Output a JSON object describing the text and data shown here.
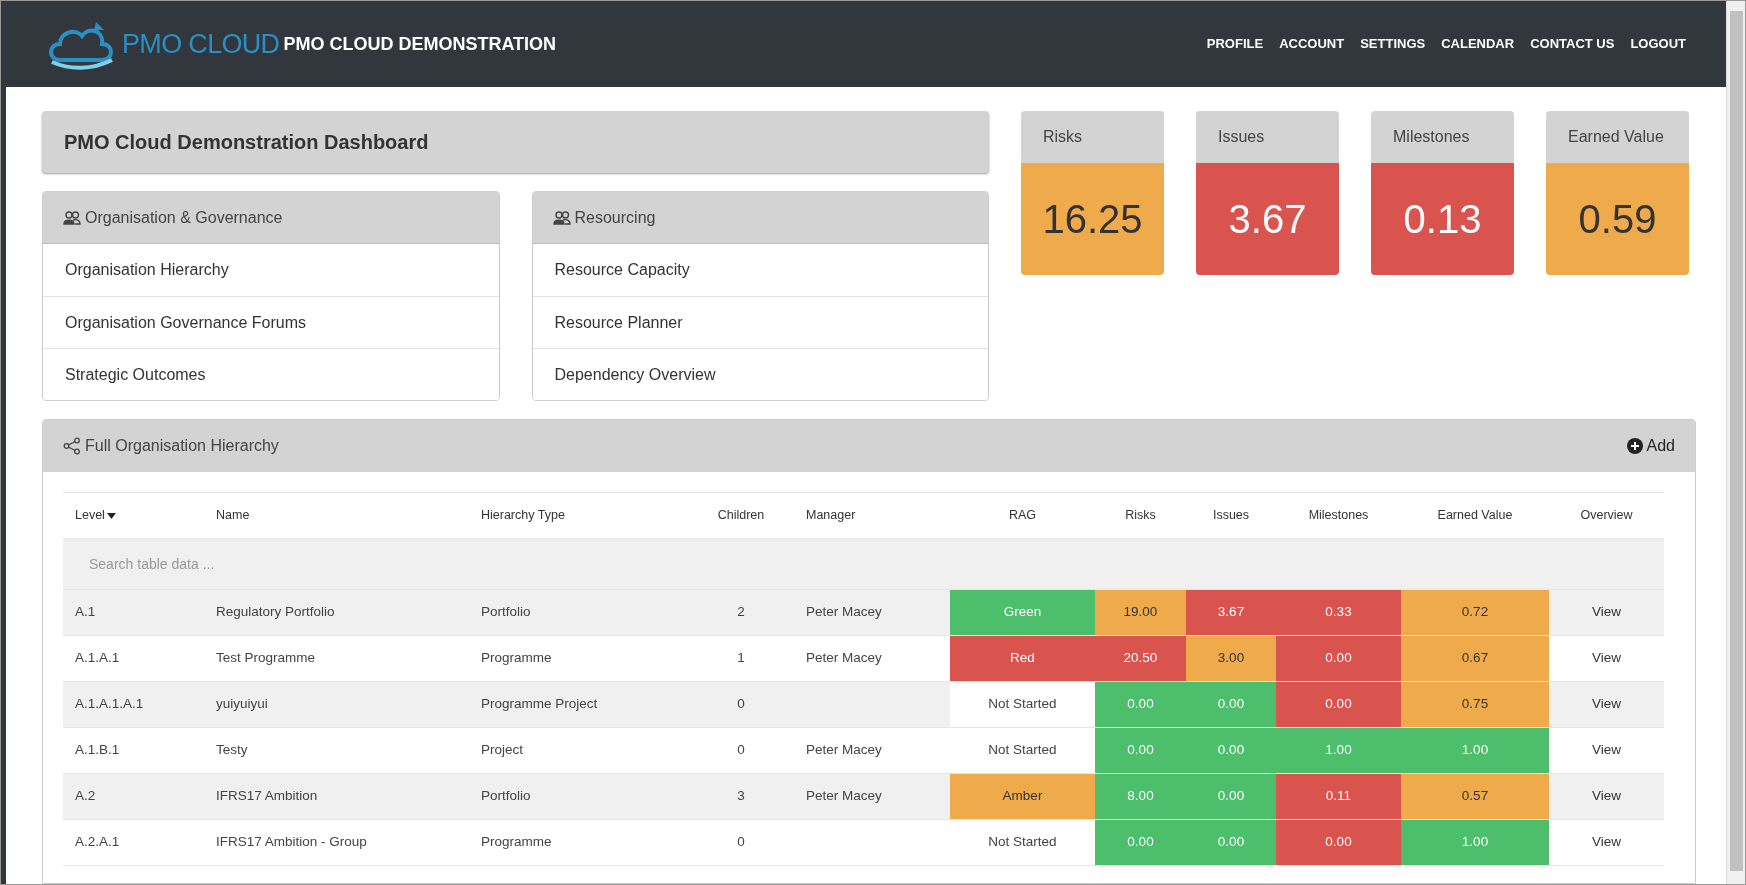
{
  "header": {
    "logo_text": "PMO CLOUD",
    "title": "PMO CLOUD DEMONSTRATION",
    "nav": [
      "PROFILE",
      "ACCOUNT",
      "SETTINGS",
      "CALENDAR",
      "CONTACT US",
      "LOGOUT"
    ]
  },
  "dashboard_title": "PMO Cloud Demonstration Dashboard",
  "panels": [
    {
      "title": "Organisation & Governance",
      "items": [
        "Organisation Hierarchy",
        "Organisation Governance Forums",
        "Strategic Outcomes"
      ]
    },
    {
      "title": "Resourcing",
      "items": [
        "Resource Capacity",
        "Resource Planner",
        "Dependency Overview"
      ]
    }
  ],
  "stats": [
    {
      "label": "Risks",
      "value": "16.25",
      "color": "#efaa4c"
    },
    {
      "label": "Issues",
      "value": "3.67",
      "color": "#d9534f"
    },
    {
      "label": "Milestones",
      "value": "0.13",
      "color": "#d9534f"
    },
    {
      "label": "Earned Value",
      "value": "0.59",
      "color": "#efaa4c"
    }
  ],
  "hierarchy": {
    "title": "Full Organisation Hierarchy",
    "add_label": "Add",
    "columns": [
      "Level",
      "Name",
      "Hierarchy Type",
      "Children",
      "Manager",
      "RAG",
      "Risks",
      "Issues",
      "Milestones",
      "Earned Value",
      "Overview"
    ],
    "search_placeholder": "Search table data ...",
    "rows": [
      {
        "level": "A.1",
        "name": "Regulatory Portfolio",
        "type": "Portfolio",
        "children": "2",
        "manager": "Peter Macey",
        "rag": {
          "text": "Green",
          "color": "#4cbe6c"
        },
        "risks": {
          "text": "19.00",
          "color": "#efaa4c"
        },
        "issues": {
          "text": "3.67",
          "color": "#d9534f"
        },
        "milestones": {
          "text": "0.33",
          "color": "#d9534f"
        },
        "earned_value": {
          "text": "0.72",
          "color": "#efaa4c"
        },
        "overview": "View"
      },
      {
        "level": "A.1.A.1",
        "name": "Test Programme",
        "type": "Programme",
        "children": "1",
        "manager": "Peter Macey",
        "rag": {
          "text": "Red",
          "color": "#d9534f"
        },
        "risks": {
          "text": "20.50",
          "color": "#d9534f"
        },
        "issues": {
          "text": "3.00",
          "color": "#efaa4c"
        },
        "milestones": {
          "text": "0.00",
          "color": "#d9534f"
        },
        "earned_value": {
          "text": "0.67",
          "color": "#efaa4c"
        },
        "overview": "View"
      },
      {
        "level": "A.1.A.1.A.1",
        "name": "yuiyuiyui",
        "type": "Programme Project",
        "children": "0",
        "rag": {
          "text": "Not Started"
        },
        "risks": {
          "text": "0.00",
          "color": "#4cbe6c"
        },
        "issues": {
          "text": "0.00",
          "color": "#4cbe6c"
        },
        "milestones": {
          "text": "0.00",
          "color": "#d9534f"
        },
        "earned_value": {
          "text": "0.75",
          "color": "#efaa4c"
        },
        "overview": "View"
      },
      {
        "level": "A.1.B.1",
        "name": "Testy",
        "type": "Project",
        "children": "0",
        "manager": "Peter Macey",
        "rag": {
          "text": "Not Started"
        },
        "risks": {
          "text": "0.00",
          "color": "#4cbe6c"
        },
        "issues": {
          "text": "0.00",
          "color": "#4cbe6c"
        },
        "milestones": {
          "text": "1.00",
          "color": "#4cbe6c"
        },
        "earned_value": {
          "text": "1.00",
          "color": "#4cbe6c"
        },
        "overview": "View"
      },
      {
        "level": "A.2",
        "name": "IFRS17 Ambition",
        "type": "Portfolio",
        "children": "3",
        "manager": "Peter Macey",
        "rag": {
          "text": "Amber",
          "color": "#efaa4c"
        },
        "risks": {
          "text": "8.00",
          "color": "#4cbe6c"
        },
        "issues": {
          "text": "0.00",
          "color": "#4cbe6c"
        },
        "milestones": {
          "text": "0.11",
          "color": "#d9534f"
        },
        "earned_value": {
          "text": "0.57",
          "color": "#efaa4c"
        },
        "overview": "View"
      },
      {
        "level": "A.2.A.1",
        "name": "IFRS17 Ambition - Group",
        "type": "Programme",
        "children": "0",
        "rag": {
          "text": "Not Started"
        },
        "risks": {
          "text": "0.00",
          "color": "#4cbe6c"
        },
        "issues": {
          "text": "0.00",
          "color": "#4cbe6c"
        },
        "milestones": {
          "text": "0.00",
          "color": "#d9534f"
        },
        "earned_value": {
          "text": "1.00",
          "color": "#4cbe6c"
        },
        "overview": "View"
      }
    ]
  }
}
